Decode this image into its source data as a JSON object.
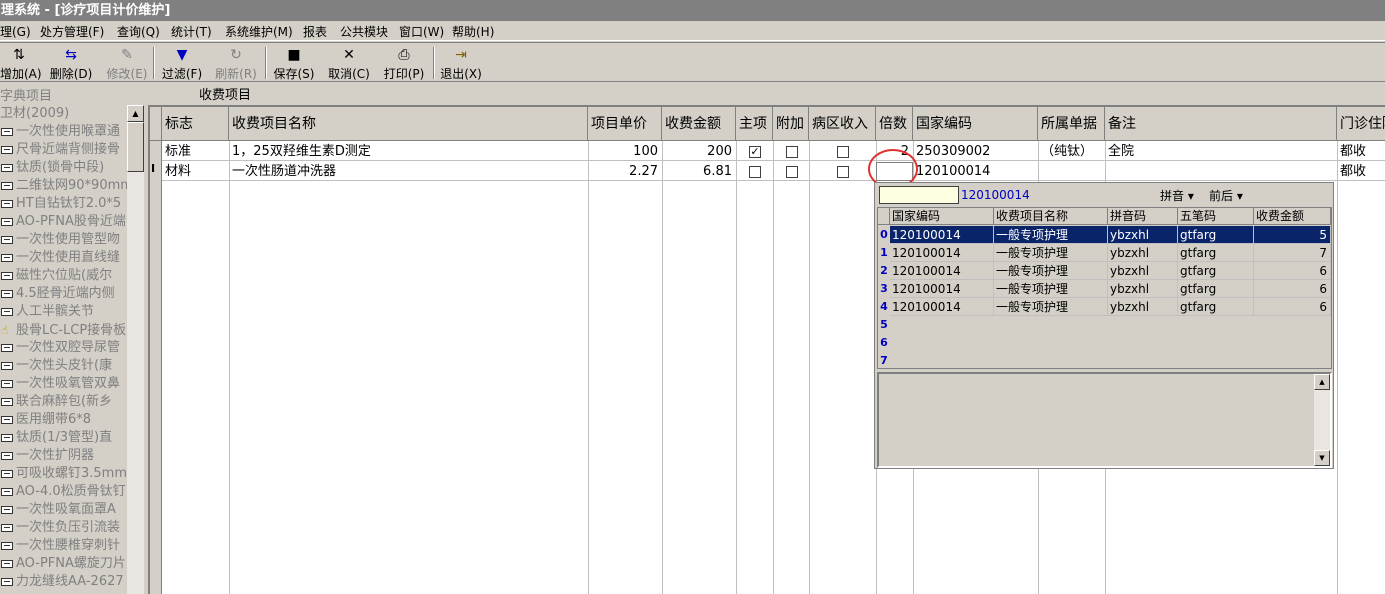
{
  "window": {
    "title": "理系统 - [诊疗项目计价维护]"
  },
  "menu": [
    {
      "label": "理(G)"
    },
    {
      "label": "处方管理(F)"
    },
    {
      "label": "查询(Q)"
    },
    {
      "label": "统计(T)"
    },
    {
      "label": "系统维护(M)"
    },
    {
      "label": "报表"
    },
    {
      "label": "公共模块"
    },
    {
      "label": "窗口(W)"
    },
    {
      "label": "帮助(H)"
    }
  ],
  "toolbar": [
    {
      "label": "增加(A)",
      "icon": "add-icon",
      "enabled": true
    },
    {
      "label": "删除(D)",
      "icon": "delete-icon",
      "enabled": true
    },
    {
      "label": "修改(E)",
      "icon": "edit-icon",
      "enabled": false
    },
    {
      "label": "过滤(F)",
      "icon": "filter-icon",
      "enabled": true
    },
    {
      "label": "刷新(R)",
      "icon": "refresh-icon",
      "enabled": false
    },
    {
      "label": "保存(S)",
      "icon": "save-icon",
      "enabled": true
    },
    {
      "label": "取消(C)",
      "icon": "cancel-icon",
      "enabled": true
    },
    {
      "label": "打印(P)",
      "icon": "print-icon",
      "enabled": true
    },
    {
      "label": "退出(X)",
      "icon": "exit-icon",
      "enabled": true
    }
  ],
  "section": {
    "dict_header": "字典项目",
    "panel_header": "收费项目"
  },
  "dict_items": [
    "卫材(2009)",
    "一次性使用喉罩通",
    "尺骨近端背侧接骨",
    "钛质(锁骨中段)",
    "二维钛网90*90mm",
    "HT自钻钛钉2.0*5",
    "AO-PFNA股骨近端",
    "一次性使用管型吻",
    "一次性使用直线缝",
    "磁性穴位贴(威尔",
    "4.5胫骨近端内侧",
    "人工半髌关节",
    "股骨LC-LCP接骨板",
    "一次性双腔导尿管",
    "一次性头皮针(康",
    "一次性吸氧管双鼻",
    "联合麻醉包(新乡",
    "医用绷带6*8",
    "钛质(1/3管型)直",
    "一次性扩阴器",
    "可吸收螺钉3.5mm",
    "AO-4.0松质骨钛钉",
    "一次性吸氧面罩A",
    "一次性负压引流装",
    "一次性腰椎穿刺针",
    "AO-PFNA螺旋刀片",
    "力龙缝线AA-2627"
  ],
  "grid": {
    "columns": [
      "标志",
      "收费项目名称",
      "项目单价",
      "收费金额",
      "主项",
      "附加",
      "病区收入",
      "倍数",
      "国家编码",
      "所属单据",
      "备注",
      "门诊住院"
    ],
    "rows": [
      {
        "flag": "标准",
        "name": "1，25双羟维生素D测定",
        "price": "100",
        "amount": "200",
        "main": true,
        "extra": false,
        "ward": false,
        "multiple": "2",
        "code": "250309002",
        "bill": "（纯钛）",
        "note": "全院",
        "op": "都收"
      },
      {
        "flag": "材料",
        "name": "一次性肠道冲洗器",
        "price": "2.27",
        "amount": "6.81",
        "main": false,
        "extra": false,
        "ward": false,
        "multiple": "",
        "code": "120100014",
        "bill": "",
        "note": "",
        "op": "都收"
      }
    ],
    "current_row_marker": "I"
  },
  "popup": {
    "query": "120100014",
    "pinyin_label": "拼音 ▾",
    "qianhou_label": "前后 ▾",
    "columns": [
      "国家编码",
      "收费项目名称",
      "拼音码",
      "五笔码",
      "收费金额"
    ],
    "row_numbers": [
      "0",
      "1",
      "2",
      "3",
      "4",
      "5",
      "6",
      "7"
    ],
    "rows": [
      {
        "code": "120100014",
        "name": "一般专项护理",
        "py": "ybzxhl",
        "wb": "gtfarg",
        "amount": "5"
      },
      {
        "code": "120100014",
        "name": "一般专项护理",
        "py": "ybzxhl",
        "wb": "gtfarg",
        "amount": "7"
      },
      {
        "code": "120100014",
        "name": "一般专项护理",
        "py": "ybzxhl",
        "wb": "gtfarg",
        "amount": "6"
      },
      {
        "code": "120100014",
        "name": "一般专项护理",
        "py": "ybzxhl",
        "wb": "gtfarg",
        "amount": "6"
      },
      {
        "code": "120100014",
        "name": "一般专项护理",
        "py": "ybzxhl",
        "wb": "gtfarg",
        "amount": "6"
      }
    ],
    "selected_index": 0
  },
  "colors": {
    "selection": "#0a246a",
    "annotation_circle": "#e03030",
    "popup_query_text": "#0000c0"
  }
}
